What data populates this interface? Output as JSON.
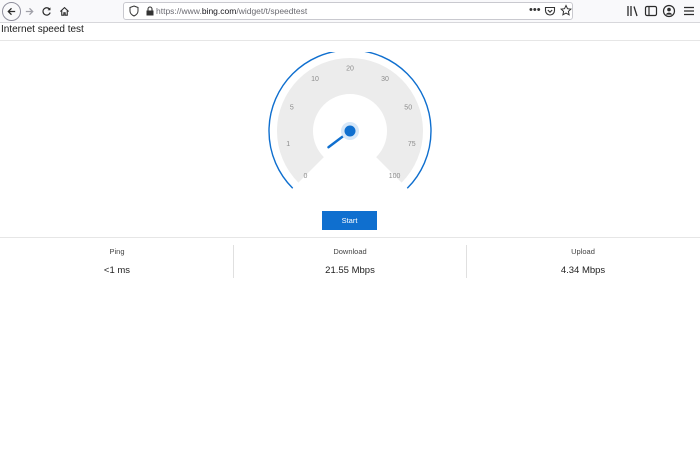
{
  "browser": {
    "url_prefix": "https://www.",
    "url_domain": "bing.com",
    "url_path": "/widget/t/speedtest",
    "url_menu": "•••"
  },
  "page": {
    "title": "Internet speed test"
  },
  "gauge": {
    "scale": [
      "0",
      "1",
      "5",
      "10",
      "20",
      "30",
      "50",
      "75",
      "100"
    ],
    "needle_value": 0,
    "colors": {
      "accent": "#0f6fcf",
      "track": "#ececec"
    }
  },
  "controls": {
    "start_label": "Start"
  },
  "results": [
    {
      "label": "Ping",
      "value": "<1 ms"
    },
    {
      "label": "Download",
      "value": "21.55 Mbps"
    },
    {
      "label": "Upload",
      "value": "4.34 Mbps"
    }
  ]
}
